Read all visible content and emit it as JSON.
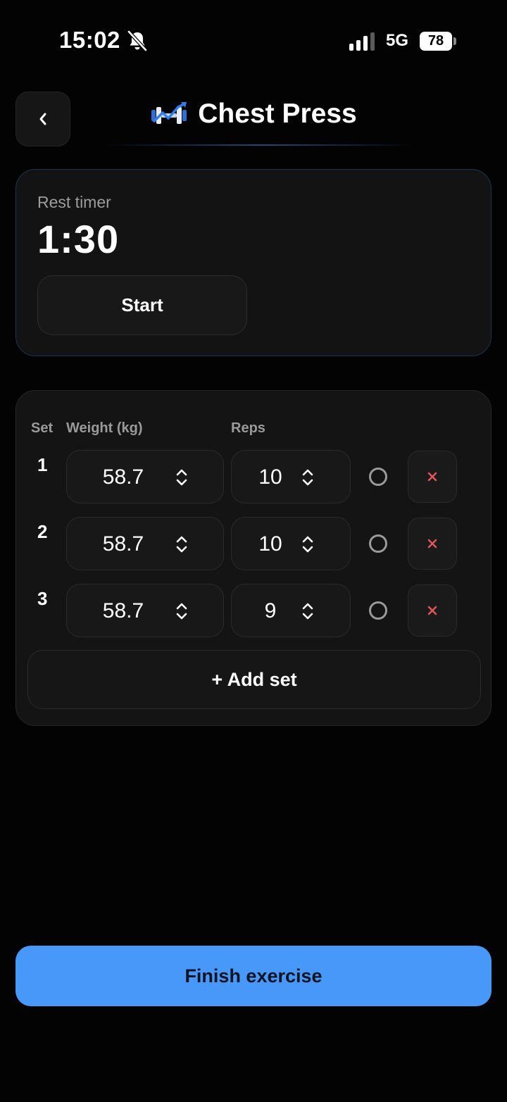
{
  "status_bar": {
    "time": "15:02",
    "network": "5G",
    "battery": "78"
  },
  "header": {
    "title": "Chest Press"
  },
  "rest_timer": {
    "label": "Rest timer",
    "value": "1:30",
    "start_label": "Start"
  },
  "sets_table": {
    "columns": {
      "set": "Set",
      "weight": "Weight (kg)",
      "reps": "Reps"
    },
    "rows": [
      {
        "set": "1",
        "weight": "58.7",
        "reps": "10"
      },
      {
        "set": "2",
        "weight": "58.7",
        "reps": "10"
      },
      {
        "set": "3",
        "weight": "58.7",
        "reps": "9"
      }
    ],
    "add_set_label": "+ Add set"
  },
  "finish_label": "Finish exercise",
  "colors": {
    "accent": "#4898fa",
    "delete": "#e0545a",
    "background": "#030303"
  },
  "icons": [
    "bell-slash-icon",
    "signal-icon",
    "battery-icon",
    "back-chevron-icon",
    "dumbbell-trend-icon",
    "updown-chevron-icon",
    "circle-check-icon",
    "x-icon"
  ]
}
